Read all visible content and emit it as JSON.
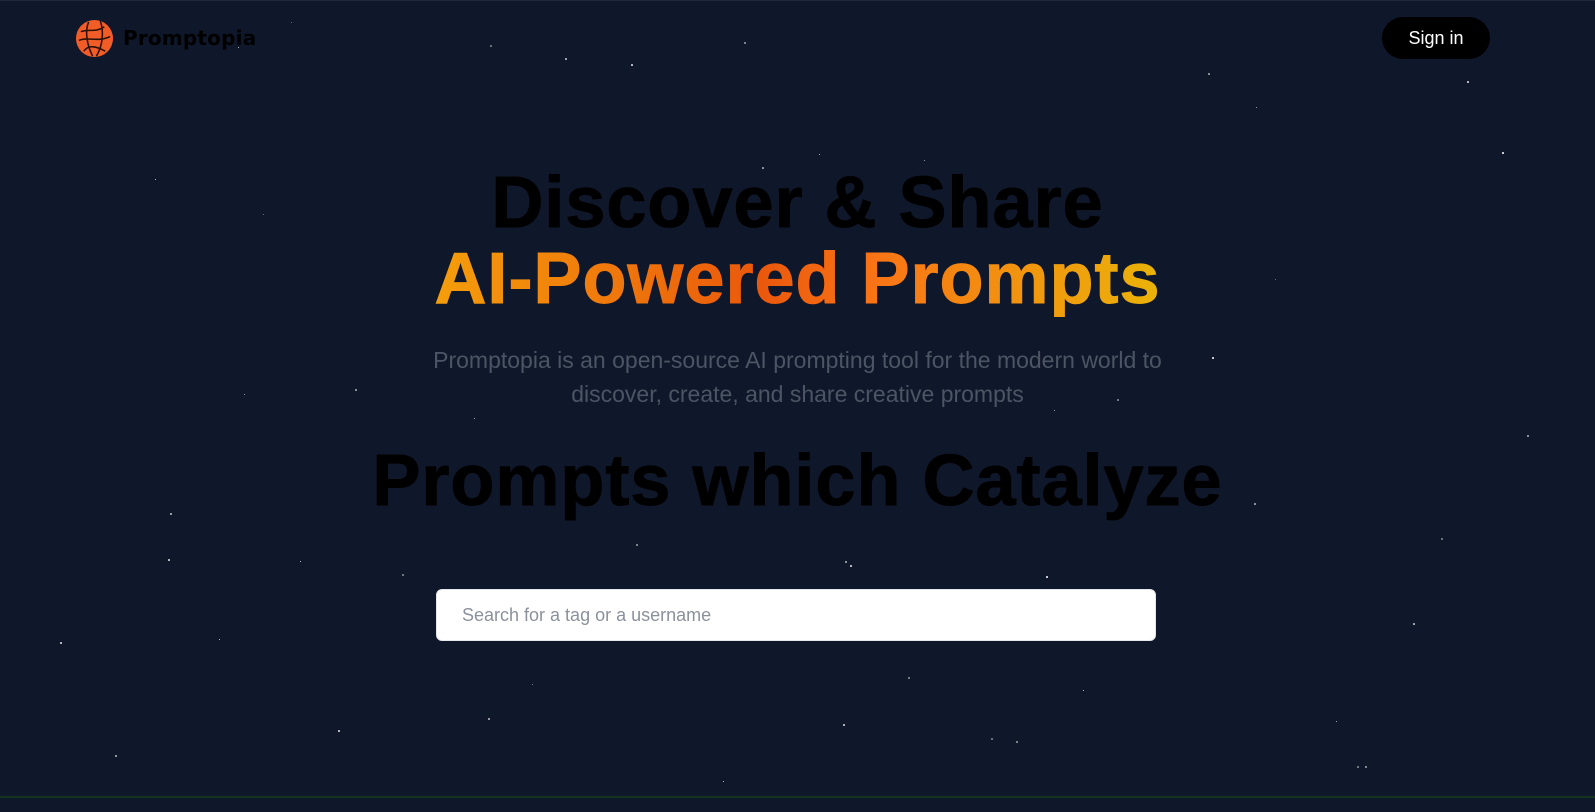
{
  "nav": {
    "brand_name": "Promptopia",
    "sign_in_label": "Sign in"
  },
  "hero": {
    "heading_line1": "Discover & Share",
    "heading_line2": "AI-Powered Prompts",
    "description": "Promptopia is an open-source AI prompting tool for the modern world to discover, create, and share creative prompts",
    "tagline": "Prompts which Catalyze"
  },
  "search": {
    "value": "",
    "placeholder": "Search for a tag or a username"
  },
  "colors": {
    "background": "#0f172a",
    "logo": "#f25c27",
    "gradient_start": "#f59e0b",
    "gradient_mid": "#ea580c",
    "gradient_end": "#eab308",
    "button": "#000000"
  },
  "icons": {
    "logo": "promptopia-logo-icon"
  }
}
